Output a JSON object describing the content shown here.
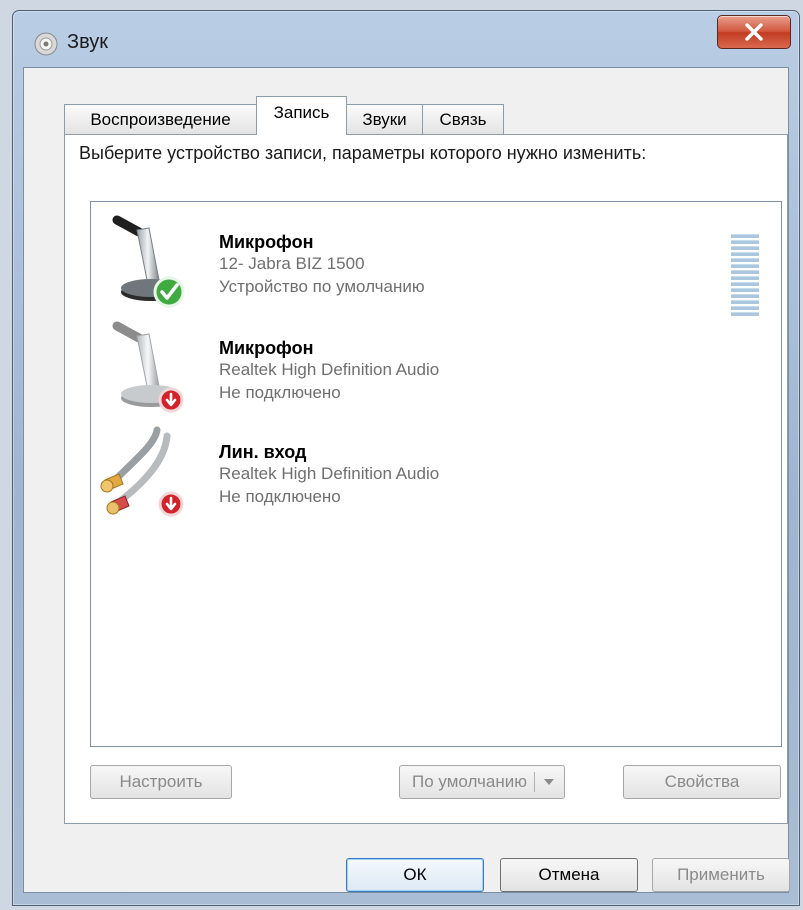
{
  "window": {
    "title": "Звук"
  },
  "tabs": [
    "Воспроизведение",
    "Запись",
    "Звуки",
    "Связь"
  ],
  "active_tab": "Запись",
  "prompt": "Выберите устройство записи, параметры которого нужно изменить:",
  "devices": [
    {
      "name": "Микрофон",
      "driver": "12- Jabra BIZ 1500",
      "status": "Устройство по умолчанию",
      "icon": "microphone-default-icon",
      "state": "default"
    },
    {
      "name": "Микрофон",
      "driver": "Realtek High Definition Audio",
      "status": "Не подключено",
      "icon": "microphone-disconnected-icon",
      "state": "disconnected"
    },
    {
      "name": "Лин. вход",
      "driver": "Realtek High Definition Audio",
      "status": "Не подключено",
      "icon": "line-in-cable-icon",
      "state": "disconnected"
    }
  ],
  "buttons": {
    "configure": "Настроить",
    "set_default": "По умолчанию",
    "properties": "Свойства",
    "ok": "ОК",
    "cancel": "Отмена",
    "apply": "Применить"
  },
  "colors": {
    "accent": "#3a7bbf",
    "close_red": "#c23c22",
    "status_ok": "#3faa3f",
    "status_down": "#d2232a"
  }
}
